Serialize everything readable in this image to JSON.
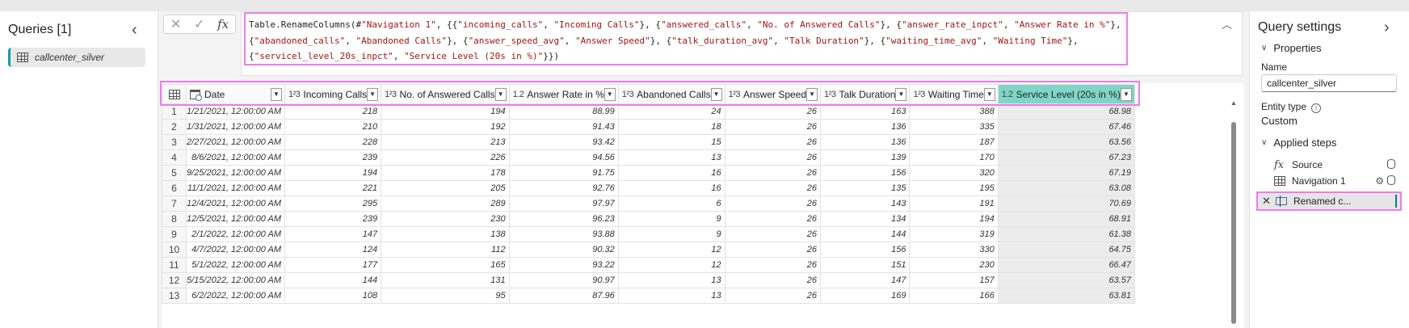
{
  "queries": {
    "title": "Queries [1]",
    "items": [
      {
        "label": "callcenter_silver"
      }
    ]
  },
  "formula": {
    "parts": [
      {
        "t": "Table.RenameColumns(#",
        "s": false
      },
      {
        "t": "\"Navigation 1\"",
        "s": true
      },
      {
        "t": ", {{",
        "s": false
      },
      {
        "t": "\"incoming_calls\"",
        "s": true
      },
      {
        "t": ", ",
        "s": false
      },
      {
        "t": "\"Incoming Calls\"",
        "s": true
      },
      {
        "t": "}, {",
        "s": false
      },
      {
        "t": "\"answered_calls\"",
        "s": true
      },
      {
        "t": ", ",
        "s": false
      },
      {
        "t": "\"No. of Answered Calls\"",
        "s": true
      },
      {
        "t": "}, {",
        "s": false
      },
      {
        "t": "\"answer_rate_inpct\"",
        "s": true
      },
      {
        "t": ", ",
        "s": false
      },
      {
        "t": "\"Answer Rate in %\"",
        "s": true
      },
      {
        "t": "},\n{",
        "s": false
      },
      {
        "t": "\"abandoned_calls\"",
        "s": true
      },
      {
        "t": ", ",
        "s": false
      },
      {
        "t": "\"Abandoned Calls\"",
        "s": true
      },
      {
        "t": "}, {",
        "s": false
      },
      {
        "t": "\"answer_speed_avg\"",
        "s": true
      },
      {
        "t": ", ",
        "s": false
      },
      {
        "t": "\"Answer Speed\"",
        "s": true
      },
      {
        "t": "}, {",
        "s": false
      },
      {
        "t": "\"talk_duration_avg\"",
        "s": true
      },
      {
        "t": ", ",
        "s": false
      },
      {
        "t": "\"Talk Duration\"",
        "s": true
      },
      {
        "t": "}, {",
        "s": false
      },
      {
        "t": "\"waiting_time_avg\"",
        "s": true
      },
      {
        "t": ", ",
        "s": false
      },
      {
        "t": "\"Waiting Time\"",
        "s": true
      },
      {
        "t": "},\n{",
        "s": false
      },
      {
        "t": "\"servicel_level_20s_inpct\"",
        "s": true
      },
      {
        "t": ", ",
        "s": false
      },
      {
        "t": "\"Service Level (20s in %)\"",
        "s": true
      },
      {
        "t": "}})",
        "s": false
      }
    ]
  },
  "grid": {
    "columns": [
      {
        "type": "date",
        "name": "Date"
      },
      {
        "type": "1²3",
        "name": "Incoming Calls"
      },
      {
        "type": "1²3",
        "name": "No. of Answered Calls"
      },
      {
        "type": "1.2",
        "name": "Answer Rate in %"
      },
      {
        "type": "1²3",
        "name": "Abandoned Calls"
      },
      {
        "type": "1²3",
        "name": "Answer Speed"
      },
      {
        "type": "1²3",
        "name": "Talk Duration"
      },
      {
        "type": "1²3",
        "name": "Waiting Time"
      },
      {
        "type": "1.2",
        "name": "Service Level (20s in %)",
        "selected": true
      }
    ],
    "rows": [
      [
        "1/21/2021, 12:00:00 AM",
        "218",
        "194",
        "88.99",
        "24",
        "26",
        "163",
        "388",
        "68.98"
      ],
      [
        "1/31/2021, 12:00:00 AM",
        "210",
        "192",
        "91.43",
        "18",
        "26",
        "136",
        "335",
        "67.46"
      ],
      [
        "2/27/2021, 12:00:00 AM",
        "228",
        "213",
        "93.42",
        "15",
        "26",
        "136",
        "187",
        "63.56"
      ],
      [
        "8/6/2021, 12:00:00 AM",
        "239",
        "226",
        "94.56",
        "13",
        "26",
        "139",
        "170",
        "67.23"
      ],
      [
        "9/25/2021, 12:00:00 AM",
        "194",
        "178",
        "91.75",
        "16",
        "26",
        "156",
        "320",
        "67.19"
      ],
      [
        "11/1/2021, 12:00:00 AM",
        "221",
        "205",
        "92.76",
        "16",
        "26",
        "135",
        "195",
        "63.08"
      ],
      [
        "12/4/2021, 12:00:00 AM",
        "295",
        "289",
        "97.97",
        "6",
        "26",
        "143",
        "191",
        "70.69"
      ],
      [
        "12/5/2021, 12:00:00 AM",
        "239",
        "230",
        "96.23",
        "9",
        "26",
        "134",
        "194",
        "68.91"
      ],
      [
        "2/1/2022, 12:00:00 AM",
        "147",
        "138",
        "93.88",
        "9",
        "26",
        "144",
        "319",
        "61.38"
      ],
      [
        "4/7/2022, 12:00:00 AM",
        "124",
        "112",
        "90.32",
        "12",
        "26",
        "156",
        "330",
        "64.75"
      ],
      [
        "5/1/2022, 12:00:00 AM",
        "177",
        "165",
        "93.22",
        "12",
        "26",
        "151",
        "230",
        "66.47"
      ],
      [
        "5/15/2022, 12:00:00 AM",
        "144",
        "131",
        "90.97",
        "13",
        "26",
        "147",
        "157",
        "63.57"
      ],
      [
        "6/2/2022, 12:00:00 AM",
        "108",
        "95",
        "87.96",
        "13",
        "26",
        "169",
        "166",
        "63.81"
      ]
    ]
  },
  "settings": {
    "title": "Query settings",
    "properties_label": "Properties",
    "name_label": "Name",
    "name_value": "callcenter_silver",
    "entity_type_label": "Entity type",
    "entity_type_value": "Custom",
    "applied_steps_label": "Applied steps",
    "steps": [
      {
        "icon": "fx",
        "label": "Source"
      },
      {
        "icon": "table",
        "label": "Navigation 1"
      },
      {
        "icon": "rename",
        "label": "Renamed c...",
        "active": true
      }
    ]
  }
}
